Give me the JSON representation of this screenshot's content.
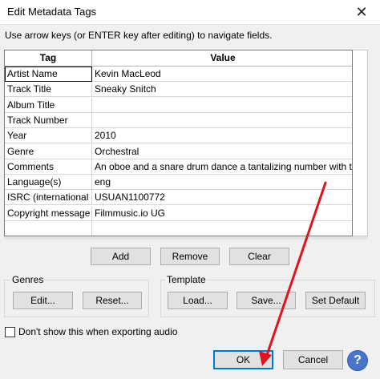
{
  "window": {
    "title": "Edit Metadata Tags",
    "close_icon": "close-icon",
    "close_glyph": "✕"
  },
  "instructions": "Use arrow keys (or ENTER key after editing) to navigate fields.",
  "grid": {
    "headers": [
      "Tag",
      "Value"
    ],
    "rows": [
      {
        "tag": "Artist Name",
        "value": "Kevin MacLeod"
      },
      {
        "tag": "Track Title",
        "value": "Sneaky Snitch"
      },
      {
        "tag": "Album Title",
        "value": ""
      },
      {
        "tag": "Track Number",
        "value": ""
      },
      {
        "tag": "Year",
        "value": "2010"
      },
      {
        "tag": "Genre",
        "value": "Orchestral"
      },
      {
        "tag": "Comments",
        "value": "An oboe and a snare drum dance a tantalizing number with t"
      },
      {
        "tag": "Language(s)",
        "value": "eng"
      },
      {
        "tag": "ISRC (international",
        "value": "USUAN1100772"
      },
      {
        "tag": "Copyright message",
        "value": "Filmmusic.io UG"
      }
    ]
  },
  "row_buttons": {
    "add": "Add",
    "remove": "Remove",
    "clear": "Clear"
  },
  "genres": {
    "label": "Genres",
    "edit": "Edit...",
    "reset": "Reset..."
  },
  "template": {
    "label": "Template",
    "load": "Load...",
    "save": "Save...",
    "set_default": "Set Default"
  },
  "dont_show": {
    "label": "Don't show this when exporting audio",
    "checked": false
  },
  "dialog_buttons": {
    "ok": "OK",
    "cancel": "Cancel",
    "help_icon": "help-icon",
    "help_glyph": "?"
  },
  "colors": {
    "accent": "#0078d7",
    "annotation_arrow": "#e0141e",
    "help_button": "#4a74c9"
  }
}
